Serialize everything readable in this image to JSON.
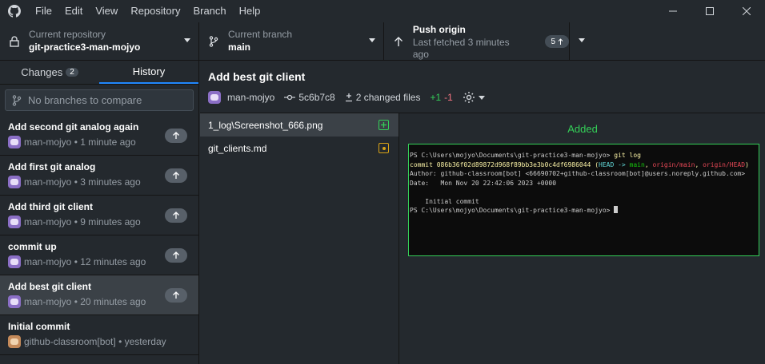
{
  "menu": [
    "File",
    "Edit",
    "View",
    "Repository",
    "Branch",
    "Help"
  ],
  "toolbar": {
    "repo_label": "Current repository",
    "repo_value": "git-practice3-man-mojyo",
    "branch_label": "Current branch",
    "branch_value": "main",
    "push_label": "Push origin",
    "push_sub": "Last fetched 3 minutes ago",
    "push_count": "5"
  },
  "sidebar": {
    "tab_changes": "Changes",
    "changes_count": "2",
    "tab_history": "History",
    "compare_placeholder": "No branches to compare",
    "commits": [
      {
        "title": "Add second git analog again",
        "author": "man-mojyo",
        "time": "1 minute ago"
      },
      {
        "title": "Add first git analog",
        "author": "man-mojyo",
        "time": "3 minutes ago"
      },
      {
        "title": "Add third git client",
        "author": "man-mojyo",
        "time": "9 minutes ago"
      },
      {
        "title": "commit up",
        "author": "man-mojyo",
        "time": "12 minutes ago"
      },
      {
        "title": "Add best git client",
        "author": "man-mojyo",
        "time": "20 minutes ago"
      },
      {
        "title": "Initial commit",
        "author": "github-classroom[bot]",
        "time": "yesterday"
      }
    ]
  },
  "commit": {
    "title": "Add best git client",
    "author": "man-mojyo",
    "sha": "5c6b7c8",
    "changed_files": "2 changed files",
    "additions": "+1",
    "deletions": "-1"
  },
  "files": [
    {
      "name": "1_log\\Screenshot_666.png",
      "status": "added"
    },
    {
      "name": "git_clients.md",
      "status": "modified"
    }
  ],
  "diff": {
    "status": "Added",
    "terminal": {
      "line1_prompt": "PS C:\\Users\\mojyo\\Documents\\git-practice3-man-mojyo> ",
      "line1_cmd": "git log",
      "commit_prefix": "commit 086b36f02d89872d968f89bb3e3b0c4df6986044 (",
      "head": "HEAD -> ",
      "main": "main",
      "sep1": ", ",
      "origin_main": "origin/main",
      "sep2": ", ",
      "origin_head": "origin/HEAD",
      "commit_suffix": ")",
      "author_line": "Author: github-classroom[bot] <66690702+github-classroom[bot]@users.noreply.github.com>",
      "date_line": "Date:   Mon Nov 20 22:42:06 2023 +0000",
      "message_line": "    Initial commit",
      "last_prompt": "PS C:\\Users\\mojyo\\Documents\\git-practice3-man-mojyo> "
    }
  },
  "colors": {
    "accent": "#2188ff",
    "added": "#34d058",
    "removed": "#f97583",
    "modified": "#d9a317"
  }
}
